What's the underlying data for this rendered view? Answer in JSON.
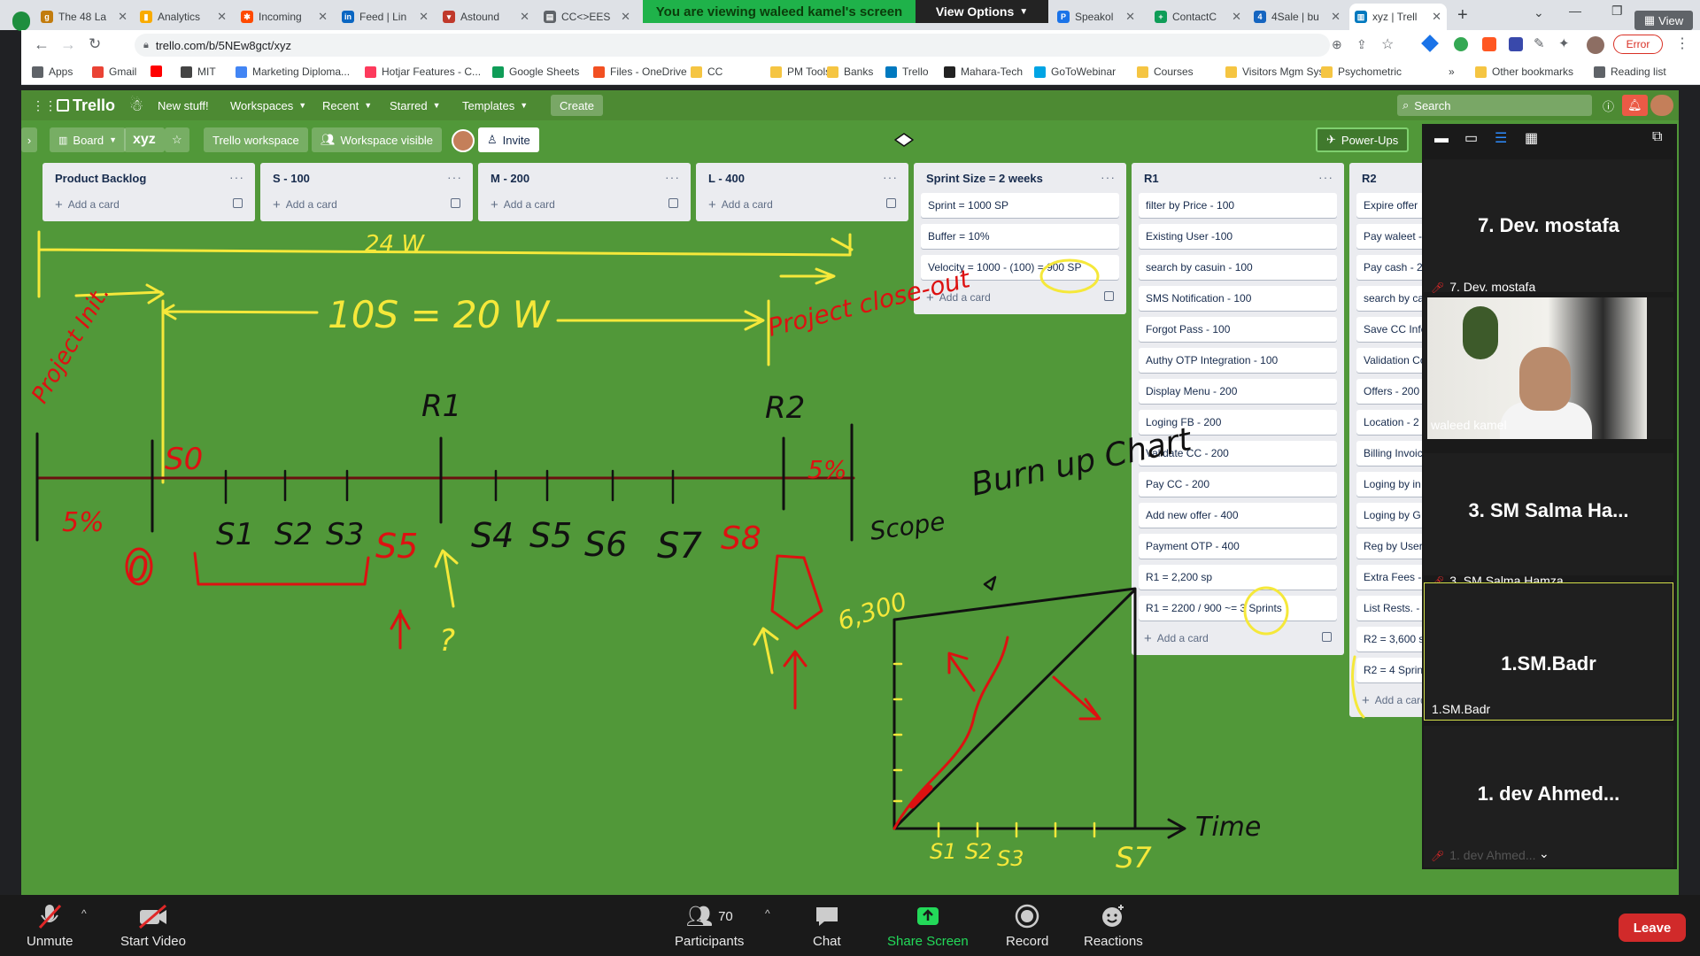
{
  "browser": {
    "tabs": [
      {
        "label": "The 48 La",
        "icon": "g-icon",
        "color": "#c27c0e"
      },
      {
        "label": "Analytics",
        "icon": "analytics-icon",
        "color": "#f9ab00"
      },
      {
        "label": "Incoming",
        "icon": "incoming-icon",
        "color": "#ff4a00"
      },
      {
        "label": "Feed | Lin",
        "icon": "linkedin-icon",
        "color": "#0a66c2"
      },
      {
        "label": "Astound",
        "icon": "astound-icon",
        "color": "#c0392b"
      },
      {
        "label": "CC<>EES",
        "icon": "document-icon",
        "color": "#5f6368"
      },
      {
        "label": "Speakol",
        "icon": "speakol-icon",
        "color": "#1a73e8"
      },
      {
        "label": "ContactC",
        "icon": "contact-icon",
        "color": "#0f9d58"
      },
      {
        "label": "4Sale | bu",
        "icon": "4sale-icon",
        "color": "#1565c0"
      },
      {
        "label": "xyz | Trell",
        "icon": "trello-icon",
        "color": "#0079bf"
      }
    ],
    "url": "trello.com/b/5NEw8gct/xyz",
    "error_label": "Error",
    "view_label": "View",
    "bookmarks": [
      {
        "label": "Apps",
        "color": "#5f6368"
      },
      {
        "label": "Gmail",
        "color": "#ea4335"
      },
      {
        "label": "",
        "color": "#ff0000"
      },
      {
        "label": "MIT",
        "color": "#444"
      },
      {
        "label": "Marketing Diploma...",
        "color": "#4285f4"
      },
      {
        "label": "Hotjar Features - C...",
        "color": "#fd3a5c"
      },
      {
        "label": "Google Sheets",
        "color": "#0f9d58"
      },
      {
        "label": "Files - OneDrive",
        "color": "#f25022"
      },
      {
        "label": "CC",
        "color": "#f5c542"
      },
      {
        "label": "PM Tools",
        "color": "#f5c542"
      },
      {
        "label": "Banks",
        "color": "#f5c542"
      },
      {
        "label": "Trello",
        "color": "#0079bf"
      },
      {
        "label": "Mahara-Tech",
        "color": "#222"
      },
      {
        "label": "GoToWebinar",
        "color": "#00a4e4"
      },
      {
        "label": "Courses",
        "color": "#f5c542"
      },
      {
        "label": "Visitors Mgm Sys",
        "color": "#f5c542"
      },
      {
        "label": "Psychometric",
        "color": "#f5c542"
      }
    ],
    "more_bookmarks": "»",
    "other_bookmarks": "Other bookmarks",
    "reading_list": "Reading list"
  },
  "zoom_share": {
    "banner": "You are viewing waleed kamel's screen",
    "view_options": "View Options"
  },
  "trello": {
    "logo": "Trello",
    "new_stuff": "New stuff!",
    "menus": [
      "Workspaces",
      "Recent",
      "Starred",
      "Templates"
    ],
    "create": "Create",
    "search_placeholder": "Search",
    "board_view": "Board",
    "board_name": "xyz",
    "workspace": "Trello workspace",
    "visibility": "Workspace visible",
    "invite": "Invite",
    "power_ups": "Power-Ups",
    "add_card": "Add a card",
    "lists": [
      {
        "title": "Product Backlog",
        "cards": []
      },
      {
        "title": "S - 100",
        "cards": []
      },
      {
        "title": "M - 200",
        "cards": []
      },
      {
        "title": "L - 400",
        "cards": []
      },
      {
        "title": "Sprint Size = 2 weeks",
        "cards": [
          "Sprint = 1000 SP",
          "Buffer = 10%",
          "Velocity = 1000 - (100) = 900 SP"
        ]
      },
      {
        "title": "R1",
        "cards": [
          "filter by Price - 100",
          "Existing User -100",
          "search by casuin - 100",
          "SMS Notification - 100",
          "Forgot Pass - 100",
          "Authy OTP Integration - 100",
          "Display Menu - 200",
          "Loging FB - 200",
          "Validate CC - 200",
          "Pay CC - 200",
          "Add new offer - 400",
          "Payment OTP - 400",
          "R1 = 2,200 sp",
          "R1 = 2200 / 900 ~= 3 Sprints"
        ]
      },
      {
        "title": "R2",
        "cards": [
          "Expire offer",
          "Pay waleet -",
          "Pay cash - 2",
          "search by ca",
          "Save CC Info",
          "Validation Cc",
          "Offers - 200",
          "Location - 2",
          "Billing Invoic",
          "Loging by in",
          "Loging by G",
          "Reg by User,",
          "Extra Fees -",
          "List Rests. -",
          "R2 = 3,600 s",
          "R2 = 4 Sprin"
        ]
      }
    ]
  },
  "annotations": {
    "top_span": "24 W",
    "formula": "10S = 20 W",
    "closeout": "Project close-out",
    "init": "Project Init.",
    "r1": "R1",
    "r2": "R2",
    "pct_left": "5%",
    "pct_right": "5%",
    "s0": "S0",
    "sprints": [
      "S1",
      "S2",
      "S3",
      "S5",
      "S4",
      "S5",
      "S6",
      "S7"
    ],
    "s5_red": "S5",
    "s8_red": "S8",
    "burnup": "Burn up Chart",
    "scope": "Scope",
    "start_val": "6,300",
    "time": "Time",
    "chart_ticks": [
      "S1",
      "S2",
      "S3"
    ],
    "s7_bottom": "S7",
    "q": "?",
    "zero": "0"
  },
  "participants_panel": {
    "tiles": [
      {
        "big": "7. Dev. mostafa",
        "small": "7. Dev. mostafa",
        "muted": true
      },
      {
        "big": "",
        "small": "waleed kamel",
        "video": true
      },
      {
        "big": "3. SM Salma Ha...",
        "small": "3. SM Salma Hamza",
        "muted": true
      },
      {
        "big": "1.SM.Badr",
        "small": "1.SM.Badr",
        "active": true
      },
      {
        "big": "1.   dev Ahmed...",
        "small": "1.  dev Ahmed...",
        "muted": true
      }
    ]
  },
  "zoom_toolbar": {
    "unmute": "Unmute",
    "start_video": "Start Video",
    "participants": "Participants",
    "participant_count": "70",
    "chat": "Chat",
    "share": "Share Screen",
    "record": "Record",
    "reactions": "Reactions",
    "leave": "Leave"
  }
}
